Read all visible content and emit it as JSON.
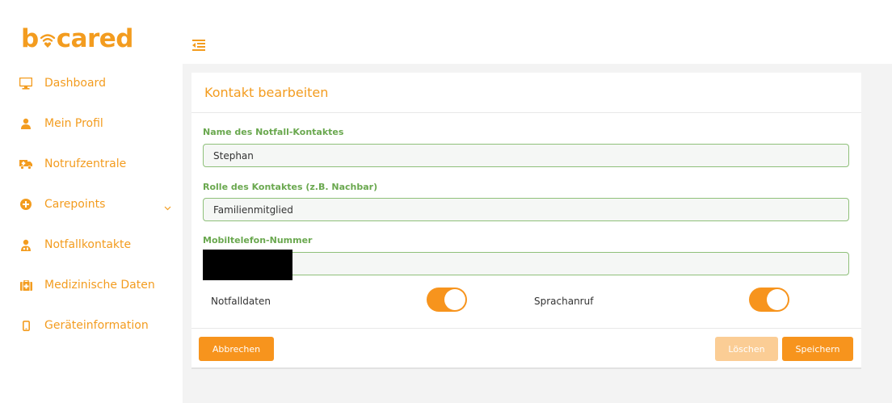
{
  "brand": {
    "logo_prefix": "b",
    "logo_suffix": "cared",
    "accent": "#f39c1f"
  },
  "sidebar": {
    "items": [
      {
        "label": "Dashboard",
        "icon": "monitor-icon"
      },
      {
        "label": "Mein Profil",
        "icon": "user-icon"
      },
      {
        "label": "Notrufzentrale",
        "icon": "ambulance-icon"
      },
      {
        "label": "Carepoints",
        "icon": "plus-circle-icon",
        "expandable": true
      },
      {
        "label": "Notfallkontakte",
        "icon": "user-md-icon"
      },
      {
        "label": "Medizinische Daten",
        "icon": "medkit-icon"
      },
      {
        "label": "Geräteinformation",
        "icon": "mobile-icon"
      }
    ]
  },
  "topbar": {
    "toggle_icon": "sidebar-toggle-icon"
  },
  "card": {
    "title": "Kontakt bearbeiten",
    "fields": {
      "name": {
        "label": "Name des Notfall-Kontaktes",
        "value": "Stephan"
      },
      "role": {
        "label": "Rolle des Kontaktes (z.B. Nachbar)",
        "value": "Familienmitglied"
      },
      "phone": {
        "label": "Mobiltelefon-Nummer",
        "value": ""
      }
    },
    "toggles": {
      "notfalldaten": {
        "label": "Notfalldaten",
        "on": true
      },
      "sprachanruf": {
        "label": "Sprachanruf",
        "on": true
      }
    },
    "buttons": {
      "cancel": "Abbrechen",
      "delete": "Löschen",
      "save": "Speichern"
    }
  }
}
